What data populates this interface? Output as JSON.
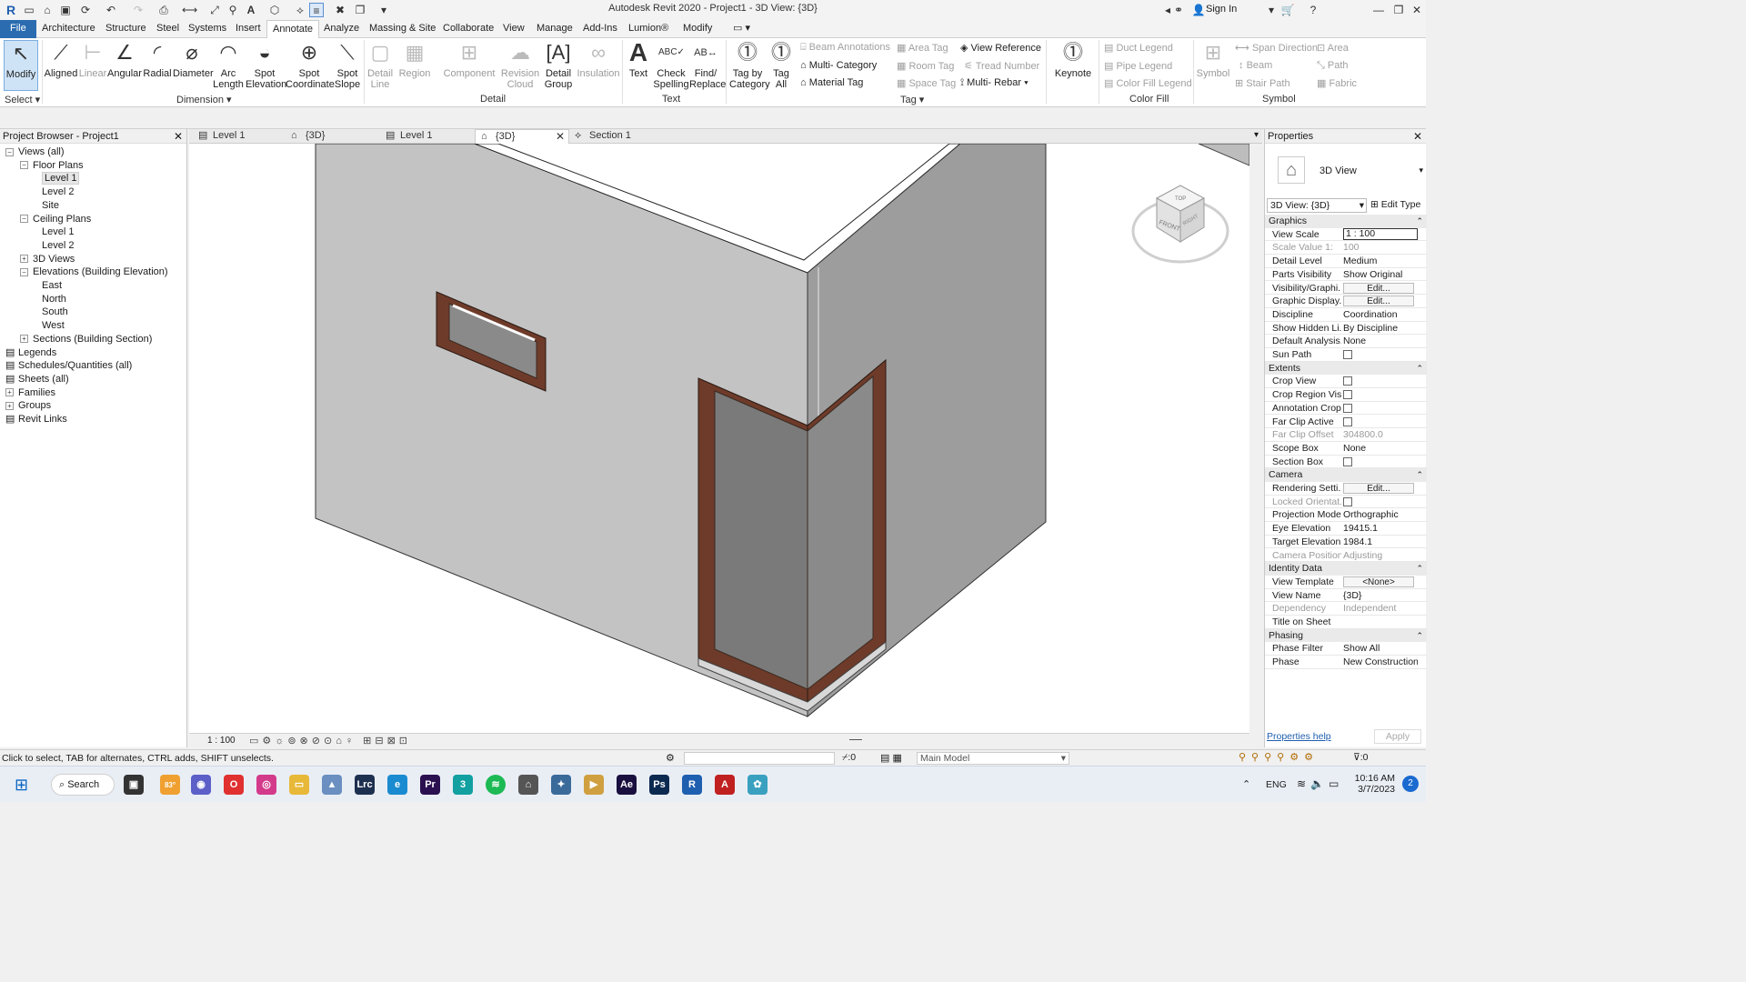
{
  "window": {
    "title": "Autodesk Revit 2020 - Project1 - 3D View: {3D}",
    "sign_in": "Sign In"
  },
  "ribbon_tabs": [
    "File",
    "Architecture",
    "Structure",
    "Steel",
    "Systems",
    "Insert",
    "Annotate",
    "Analyze",
    "Massing & Site",
    "Collaborate",
    "View",
    "Manage",
    "Add-Ins",
    "Lumion®",
    "Modify"
  ],
  "ribbon": {
    "select": {
      "modify": "Modify",
      "label": "Select"
    },
    "dimension": {
      "tools": [
        "Aligned",
        "Linear",
        "Angular",
        "Radial",
        "Diameter",
        "Arc\nLength",
        "Spot\nElevation",
        "Spot\nCoordinate",
        "Spot\nSlope"
      ],
      "label": "Dimension"
    },
    "detail": {
      "tools": [
        "Detail\nLine",
        "Region",
        "Component",
        "Revision\nCloud",
        "Detail\nGroup",
        "Insulation"
      ],
      "label": "Detail"
    },
    "text": {
      "tools": [
        "Text",
        "Check\nSpelling",
        "Find/\nReplace"
      ],
      "label": "Text"
    },
    "tag": {
      "tools": [
        "Tag by\nCategory",
        "Tag\nAll"
      ],
      "small": [
        "Beam Annotations",
        "Multi- Category",
        "Material Tag",
        "Area Tag",
        "Room Tag",
        "Space Tag",
        "View Reference",
        "Tread Number",
        "Multi- Rebar"
      ],
      "keynote": "Keynote",
      "label": "Tag"
    },
    "color_fill": {
      "small": [
        "Duct Legend",
        "Pipe Legend",
        "Color Fill Legend"
      ],
      "label": "Color Fill"
    },
    "symbol": {
      "tools": [
        "Symbol"
      ],
      "small": [
        "Span Direction",
        "Beam",
        "Stair Path",
        "Area",
        "Path",
        "Fabric"
      ],
      "label": "Symbol"
    }
  },
  "browser": {
    "title": "Project Browser - Project1",
    "items": [
      {
        "label": "Views (all)",
        "indent": 0,
        "exp": "-"
      },
      {
        "label": "Floor Plans",
        "indent": 1,
        "exp": "-"
      },
      {
        "label": "Level 1",
        "indent": 2,
        "exp": "",
        "selected": true
      },
      {
        "label": "Level 2",
        "indent": 2,
        "exp": ""
      },
      {
        "label": "Site",
        "indent": 2,
        "exp": ""
      },
      {
        "label": "Ceiling Plans",
        "indent": 1,
        "exp": "-"
      },
      {
        "label": "Level 1",
        "indent": 2,
        "exp": ""
      },
      {
        "label": "Level 2",
        "indent": 2,
        "exp": ""
      },
      {
        "label": "3D Views",
        "indent": 1,
        "exp": "+"
      },
      {
        "label": "Elevations (Building Elevation)",
        "indent": 1,
        "exp": "-"
      },
      {
        "label": "East",
        "indent": 2,
        "exp": ""
      },
      {
        "label": "North",
        "indent": 2,
        "exp": ""
      },
      {
        "label": "South",
        "indent": 2,
        "exp": ""
      },
      {
        "label": "West",
        "indent": 2,
        "exp": ""
      },
      {
        "label": "Sections (Building Section)",
        "indent": 1,
        "exp": "+"
      },
      {
        "label": "Legends",
        "indent": 0,
        "exp": ""
      },
      {
        "label": "Schedules/Quantities (all)",
        "indent": 0,
        "exp": ""
      },
      {
        "label": "Sheets (all)",
        "indent": 0,
        "exp": ""
      },
      {
        "label": "Families",
        "indent": 0,
        "exp": "+"
      },
      {
        "label": "Groups",
        "indent": 0,
        "exp": "+"
      },
      {
        "label": "Revit Links",
        "indent": 0,
        "exp": ""
      }
    ]
  },
  "view_tabs": [
    "Level 1",
    "{3D}",
    "Level 1",
    "{3D}",
    "Section 1"
  ],
  "view_cube": {
    "top": "TOP",
    "front": "FRONT",
    "right": "RIGHT"
  },
  "view_control": {
    "scale": "1 : 100"
  },
  "properties": {
    "title": "Properties",
    "type": "3D View",
    "selector": "3D View: {3D}",
    "edit_type": "Edit Type",
    "groups": [
      {
        "name": "Graphics",
        "rows": [
          {
            "k": "View Scale",
            "v": "1 : 100"
          },
          {
            "k": "Scale Value    1:",
            "v": "100",
            "dis": true
          },
          {
            "k": "Detail Level",
            "v": "Medium"
          },
          {
            "k": "Parts Visibility",
            "v": "Show Original"
          },
          {
            "k": "Visibility/Graphi...",
            "v": "Edit...",
            "btn": true
          },
          {
            "k": "Graphic Display...",
            "v": "Edit...",
            "btn": true
          },
          {
            "k": "Discipline",
            "v": "Coordination"
          },
          {
            "k": "Show Hidden Li...",
            "v": "By Discipline"
          },
          {
            "k": "Default Analysis...",
            "v": "None"
          },
          {
            "k": "Sun Path",
            "v": "",
            "chk": true
          }
        ]
      },
      {
        "name": "Extents",
        "rows": [
          {
            "k": "Crop View",
            "v": "",
            "chk": true
          },
          {
            "k": "Crop Region Vis...",
            "v": "",
            "chk": true
          },
          {
            "k": "Annotation Crop",
            "v": "",
            "chk": true
          },
          {
            "k": "Far Clip Active",
            "v": "",
            "chk": true
          },
          {
            "k": "Far Clip Offset",
            "v": "304800.0",
            "dis": true
          },
          {
            "k": "Scope Box",
            "v": "None"
          },
          {
            "k": "Section Box",
            "v": "",
            "chk": true
          }
        ]
      },
      {
        "name": "Camera",
        "rows": [
          {
            "k": "Rendering Setti...",
            "v": "Edit...",
            "btn": true
          },
          {
            "k": "Locked Orientat...",
            "v": "",
            "chk": true,
            "dis": true
          },
          {
            "k": "Projection Mode",
            "v": "Orthographic"
          },
          {
            "k": "Eye Elevation",
            "v": "19415.1"
          },
          {
            "k": "Target Elevation",
            "v": "1984.1"
          },
          {
            "k": "Camera Position",
            "v": "Adjusting",
            "dis": true
          }
        ]
      },
      {
        "name": "Identity Data",
        "rows": [
          {
            "k": "View Template",
            "v": "<None>",
            "btn": true
          },
          {
            "k": "View Name",
            "v": "{3D}"
          },
          {
            "k": "Dependency",
            "v": "Independent",
            "dis": true
          },
          {
            "k": "Title on Sheet",
            "v": ""
          }
        ]
      },
      {
        "name": "Phasing",
        "rows": [
          {
            "k": "Phase Filter",
            "v": "Show All"
          },
          {
            "k": "Phase",
            "v": "New Construction"
          }
        ]
      }
    ],
    "help": "Properties help",
    "apply": "Apply"
  },
  "status": {
    "text": "Click to select, TAB for alternates, CTRL adds, SHIFT unselects.",
    "model": "Main Model",
    "count": ":0",
    "filter": ":0"
  },
  "taskbar": {
    "search": "Search",
    "weather": "83°",
    "lang": "ENG",
    "time": "10:16 AM",
    "date": "3/7/2023",
    "notif": "2"
  }
}
